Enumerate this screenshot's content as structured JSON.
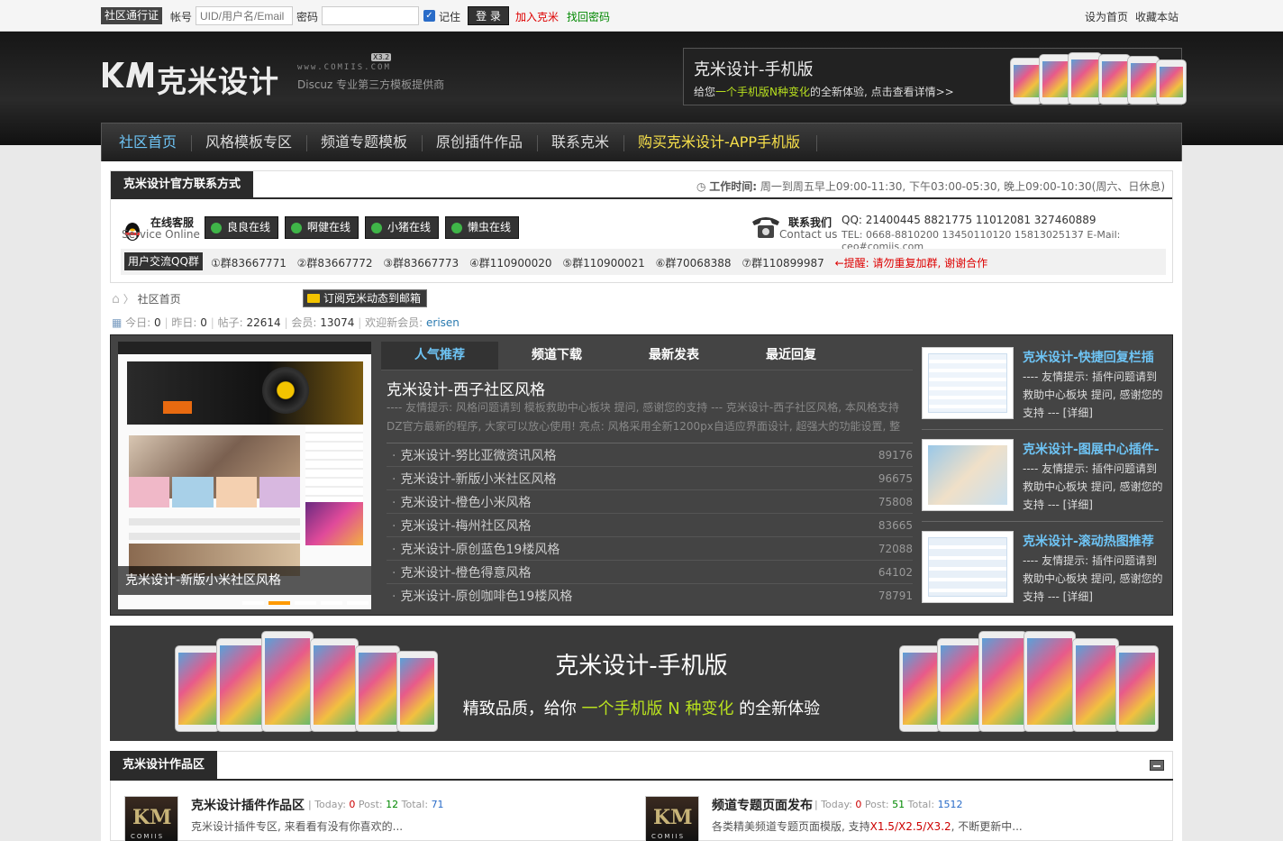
{
  "topbar": {
    "pass_label": "社区通行证",
    "account_label": "帐号",
    "account_placeholder": "UID/用户名/Email",
    "password_label": "密码",
    "remember_label": "记住",
    "login_button": "登 录",
    "register_link": "加入克米",
    "recover_link": "找回密码",
    "set_home": "设为首页",
    "bookmark": "收藏本站"
  },
  "header": {
    "logo_text": "克米设计",
    "logo_url": "www.COMIIS.COM",
    "logo_version": "X3.2",
    "logo_sub": "Discuz 专业第三方模板提供商",
    "banner_title": "克米设计-手机版",
    "banner_sub_pre": "给您",
    "banner_sub_hl": "一个手机版N种变化",
    "banner_sub_post": "的全新体验, 点击查看详情>>"
  },
  "nav": [
    {
      "label": "社区首页",
      "active": true
    },
    {
      "label": "风格模板专区"
    },
    {
      "label": "频道专题模板"
    },
    {
      "label": "原创插件作品"
    },
    {
      "label": "联系克米"
    },
    {
      "label": "购买克米设计-APP手机版",
      "highlight": true
    }
  ],
  "contact_box": {
    "title": "克米设计官方联系方式",
    "worktime_label": "工作时间:",
    "worktime": "周一到周五早上09:00-11:30, 下午03:00-05:30, 晚上09:00-10:30(周六、日休息)",
    "kefu_title": "在线客服",
    "kefu_sub": "Service Online",
    "qq_buttons": [
      "良良在线",
      "啊健在线",
      "小猪在线",
      "懒虫在线"
    ],
    "contact_title": "联系我们",
    "contact_sub": "Contact us",
    "contact_qq": "QQ: 21400445 8821775 11012081 327460889",
    "contact_tel": "TEL: 0668-8810200 13450110120 15813025137 E-Mail: ceo#comiis.com",
    "group_label": "用户交流QQ群",
    "groups": [
      "①群83667771",
      "②群83667772",
      "③群83667773",
      "④群110900020",
      "⑤群110900021",
      "⑥群70068388",
      "⑦群110899987"
    ],
    "group_warn": "←提醒: 请勿重复加群, 谢谢合作"
  },
  "breadcrumb": {
    "home_label": "社区首页",
    "subscribe": "订阅克米动态到邮箱"
  },
  "stats": {
    "today_label": "今日:",
    "today": "0",
    "yesterday_label": "昨日:",
    "yesterday": "0",
    "posts_label": "帖子:",
    "posts": "22614",
    "members_label": "会员:",
    "members": "13074",
    "welcome_label": "欢迎新会员:",
    "new_member": "erisen"
  },
  "feature": {
    "slide_caption": "克米设计-新版小米社区风格",
    "slide_count": 5,
    "slide_active": 2,
    "tabs": [
      "人气推荐",
      "频道下载",
      "最新发表",
      "最近回复"
    ],
    "hot_title": "克米设计-西子社区风格",
    "hot_desc": "---- 友情提示: 风格问题请到 模板救助中心板块 提问, 感谢您的支持 --- 克米设计-西子社区风格, 本风格支持DZ官方最新的程序, 大家可以放心使用! 亮点: 风格采用全新1200px自适应界面设计, 超强大的功能设置, 整",
    "list": [
      {
        "title": "克米设计-努比亚微资讯风格",
        "num": "89176"
      },
      {
        "title": "克米设计-新版小米社区风格",
        "num": "96675"
      },
      {
        "title": "克米设计-橙色小米风格",
        "num": "75808"
      },
      {
        "title": "克米设计-梅州社区风格",
        "num": "83665"
      },
      {
        "title": "克米设计-原创蓝色19楼风格",
        "num": "72088"
      },
      {
        "title": "克米设计-橙色得意风格",
        "num": "64102"
      },
      {
        "title": "克米设计-原创咖啡色19楼风格",
        "num": "78791"
      }
    ],
    "side": [
      {
        "title": "克米设计-快捷回复栏插",
        "desc": "---- 友情提示: 插件问题请到救助中心板块 提问, 感谢您的支持 --- [详细]"
      },
      {
        "title": "克米设计-图展中心插件-",
        "desc": "---- 友情提示: 插件问题请到救助中心板块 提问, 感谢您的支持 --- [详细]"
      },
      {
        "title": "克米设计-滚动热图推荐",
        "desc": "---- 友情提示: 插件问题请到救助中心板块 提问, 感谢您的支持 --- [详细]"
      }
    ]
  },
  "mobile_banner": {
    "title": "克米设计-手机版",
    "sub_pre": "精致品质，给你 ",
    "sub_hl": "一个手机版 N 种变化",
    "sub_post": " 的全新体验"
  },
  "works": {
    "title": "克米设计作品区",
    "forums": [
      {
        "icon_text": "KM",
        "icon_sub": "COMIIS",
        "name": "克米设计插件作品区",
        "today_label": "Today:",
        "today": "0",
        "post_label": "Post:",
        "post": "12",
        "total_label": "Total:",
        "total": "71",
        "desc": "克米设计插件专区, 来看看有没有你喜欢的..."
      },
      {
        "icon_text": "KM",
        "icon_sub": "COMIIS",
        "name": "频道专题页面发布",
        "today_label": "Today:",
        "today": "0",
        "post_label": "Post:",
        "post": "51",
        "total_label": "Total:",
        "total": "1512",
        "desc_pre": "各类精美频道专题页面模版, 支持",
        "desc_hl": "X1.5/X2.5/X3.2",
        "desc_post": ", 不断更新中..."
      }
    ]
  },
  "colors": {
    "accent_blue": "#6ec4f5",
    "accent_green": "#b8e01f",
    "warn_red": "#dd0000",
    "nav_yellow": "#f7e04a"
  }
}
